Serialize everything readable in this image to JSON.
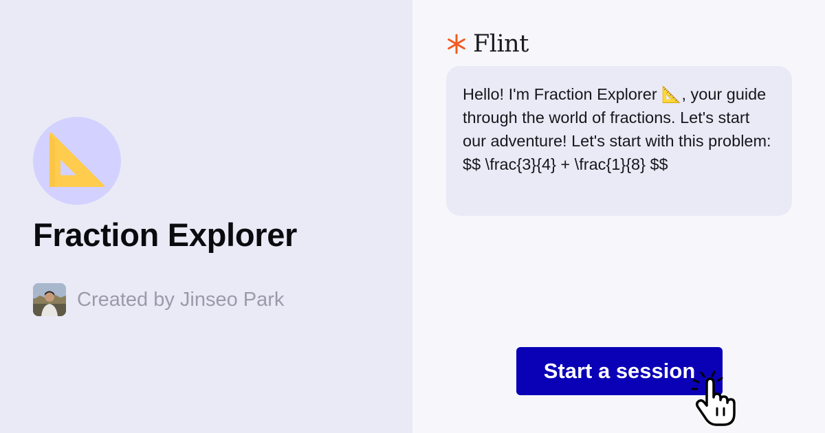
{
  "bot": {
    "name": "Fraction Explorer",
    "avatar_icon": "triangular-ruler-icon",
    "creator_label": "Created by Jinseo Park"
  },
  "brand": {
    "name": "Flint",
    "icon": "asterisk-icon",
    "accent_color": "#f25a1f"
  },
  "message": {
    "text": "Hello! I'm Fraction Explorer 📐, your guide through the world of fractions. Let's start our adventure! Let's start with this problem: $$ \\frac{3}{4} + \\frac{1}{8} $$"
  },
  "cta": {
    "label": "Start a session",
    "color": "#0a00b6",
    "cursor_icon": "pointer-hand-cursor-icon"
  },
  "colors": {
    "left_background": "#eaeaf6",
    "right_background": "#f7f7fb",
    "avatar_circle": "#d3d1ff",
    "ruler": "#ffcc4d"
  }
}
